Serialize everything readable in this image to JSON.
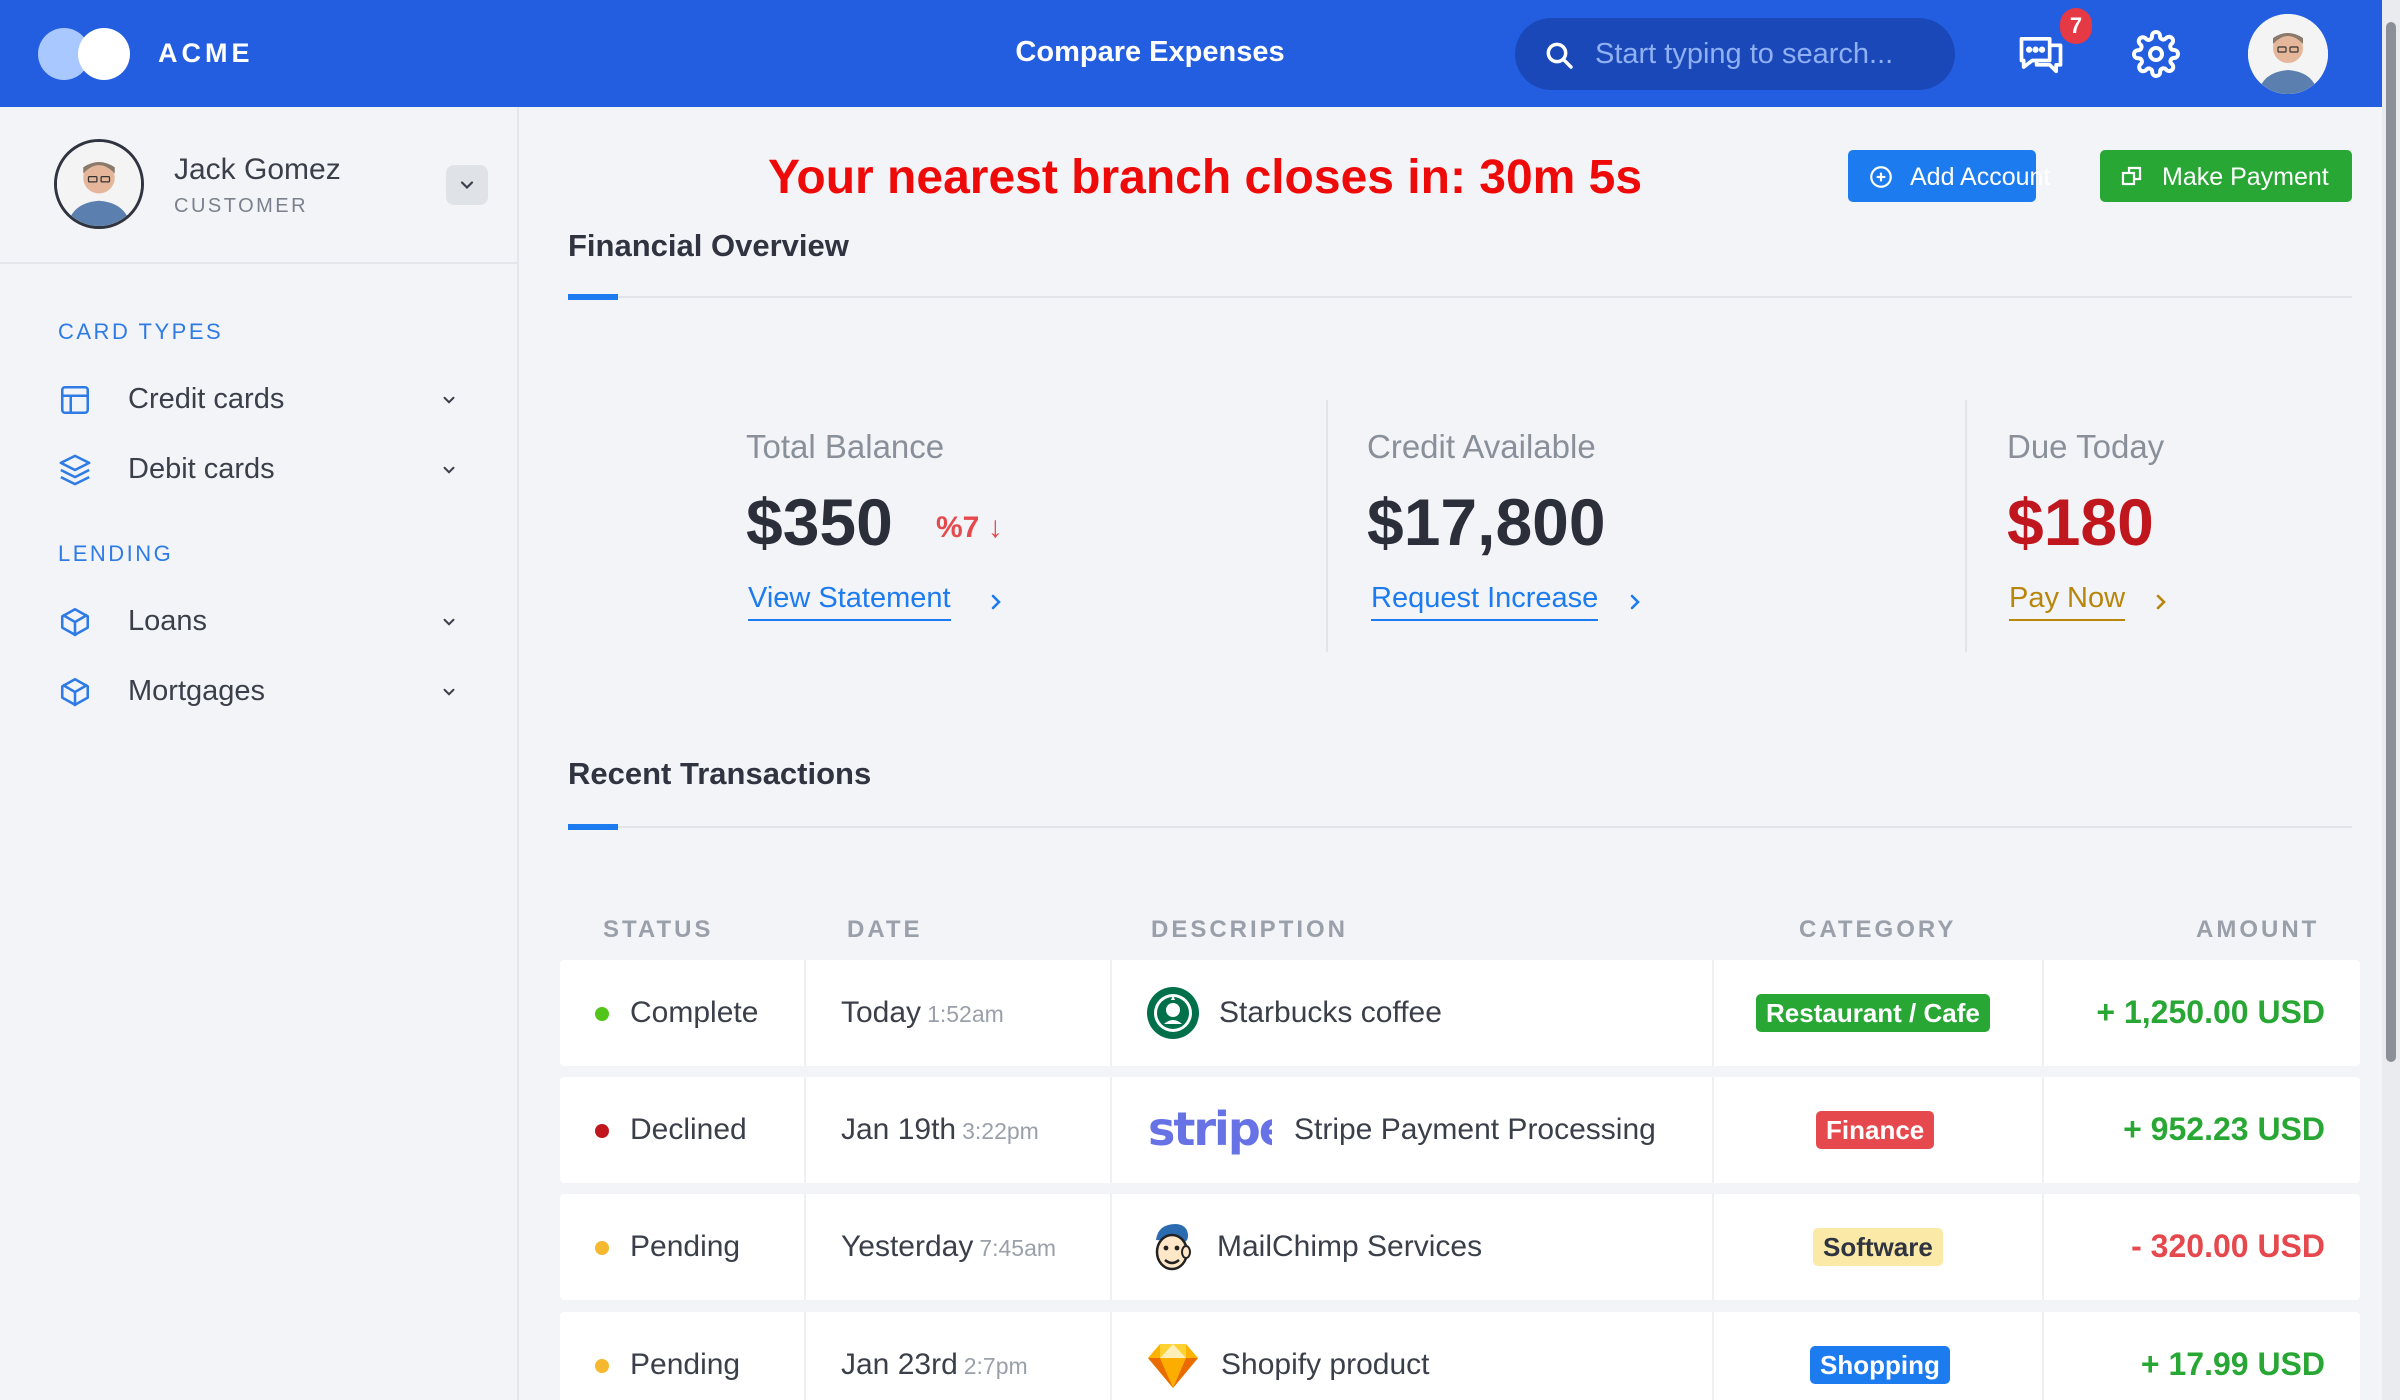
{
  "header": {
    "brand": "ACME",
    "title": "Compare Expenses",
    "search_placeholder": "Start typing to search...",
    "messages_count": "7"
  },
  "sidebar": {
    "user": {
      "name": "Jack Gomez",
      "role": "CUSTOMER"
    },
    "sections": [
      {
        "title": "CARD TYPES",
        "items": [
          {
            "label": "Credit cards",
            "icon": "layout-icon"
          },
          {
            "label": "Debit cards",
            "icon": "layers-icon"
          }
        ]
      },
      {
        "title": "LENDING",
        "items": [
          {
            "label": "Loans",
            "icon": "box-icon"
          },
          {
            "label": "Mortgages",
            "icon": "box-icon"
          }
        ]
      }
    ]
  },
  "main": {
    "countdown": "Your nearest branch closes in: 30m 5s",
    "actions": {
      "add_account": "Add Account",
      "make_payment": "Make Payment"
    },
    "overview_title": "Financial Overview",
    "stats": [
      {
        "label": "Total Balance",
        "value": "$350",
        "trend": "%7",
        "link": "View Statement"
      },
      {
        "label": "Credit Available",
        "value": "$17,800",
        "link": "Request Increase"
      },
      {
        "label": "Due Today",
        "value": "$180",
        "link": "Pay Now"
      }
    ],
    "transactions_title": "Recent Transactions",
    "table": {
      "columns": [
        "STATUS",
        "DATE",
        "DESCRIPTION",
        "CATEGORY",
        "AMOUNT"
      ],
      "rows": [
        {
          "status": "Complete",
          "status_color": "#52c41a",
          "date": "Today",
          "time": "1:52am",
          "logo": "starbucks-logo",
          "description": "Starbucks coffee",
          "category": "Restaurant / Cafe",
          "cat_bg": "#28a735",
          "cat_fg": "#ffffff",
          "amount": "+ 1,250.00 USD",
          "amount_color": "#28a735"
        },
        {
          "status": "Declined",
          "status_color": "#c0161e",
          "date": "Jan 19th",
          "time": "3:22pm",
          "logo": "stripe-logo",
          "description": "Stripe Payment Processing",
          "category": "Finance",
          "cat_bg": "#e5484d",
          "cat_fg": "#ffffff",
          "amount": "+ 952.23 USD",
          "amount_color": "#28a735"
        },
        {
          "status": "Pending",
          "status_color": "#f5b82e",
          "date": "Yesterday",
          "time": "7:45am",
          "logo": "mailchimp-logo",
          "description": "MailChimp Services",
          "category": "Software",
          "cat_bg": "#fbe9a8",
          "cat_fg": "#2f3440",
          "amount": "- 320.00 USD",
          "amount_color": "#e5484d"
        },
        {
          "status": "Pending",
          "status_color": "#f5b82e",
          "date": "Jan 23rd",
          "time": "2:7pm",
          "logo": "sketch-logo",
          "description": "Shopify product",
          "category": "Shopping",
          "cat_bg": "#1d7bf0",
          "cat_fg": "#ffffff",
          "amount": "+ 17.99 USD",
          "amount_color": "#28a735"
        }
      ]
    }
  },
  "colors": {
    "primary": "#245ee0",
    "accent": "#1d7bf0",
    "success": "#28a735",
    "danger": "#e5484d",
    "due": "#c0161e",
    "warning_link": "#b8860b"
  }
}
